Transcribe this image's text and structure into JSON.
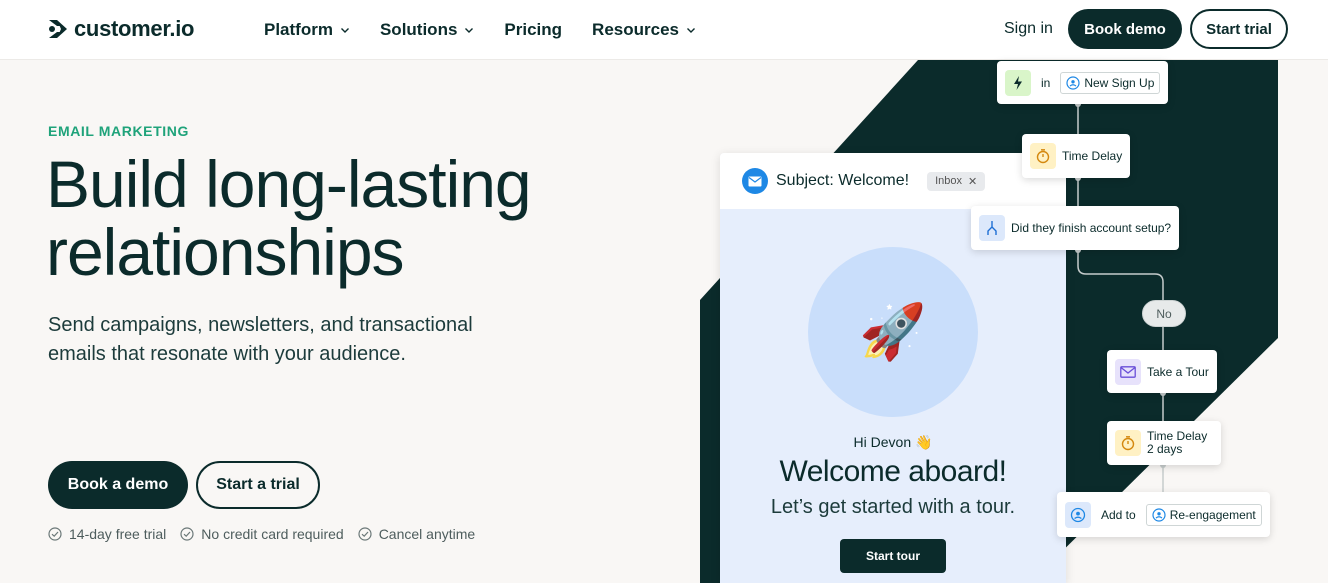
{
  "nav": {
    "logo_text": "customer.io",
    "links": [
      {
        "label": "Platform",
        "has_dropdown": true
      },
      {
        "label": "Solutions",
        "has_dropdown": true
      },
      {
        "label": "Pricing",
        "has_dropdown": false
      },
      {
        "label": "Resources",
        "has_dropdown": true
      }
    ],
    "sign_in": "Sign in",
    "book_demo": "Book demo",
    "start_trial": "Start trial"
  },
  "hero": {
    "eyebrow": "EMAIL MARKETING",
    "title_line1": "Build long-lasting",
    "title_line2": "relationships",
    "subtitle": "Send campaigns, newsletters, and transactional emails that resonate with your audience.",
    "cta_primary": "Book a demo",
    "cta_secondary": "Start a trial",
    "checks": [
      "14-day free trial",
      "No credit card required",
      "Cancel anytime"
    ]
  },
  "email_preview": {
    "subject": "Subject: Welcome!",
    "inbox_chip": "Inbox",
    "greeting": "Hi Devon 👋",
    "headline": "Welcome aboard!",
    "tagline": "Let’s get started with a tour.",
    "button": "Start tour",
    "hero_emoji": "🚀"
  },
  "workflow": {
    "trigger_in": "in",
    "trigger_segment": "New Sign Up",
    "delay1": "Time Delay",
    "branch_question": "Did they finish account setup?",
    "branch_no": "No",
    "action_email": "Take a Tour",
    "delay2_title": "Time Delay",
    "delay2_value": "2 days",
    "add_to": "Add to",
    "add_segment": "Re-engagement"
  },
  "colors": {
    "brand_dark": "#0b2b2b",
    "accent_green": "#1fa37a",
    "page_bg": "#f9f7f5"
  }
}
